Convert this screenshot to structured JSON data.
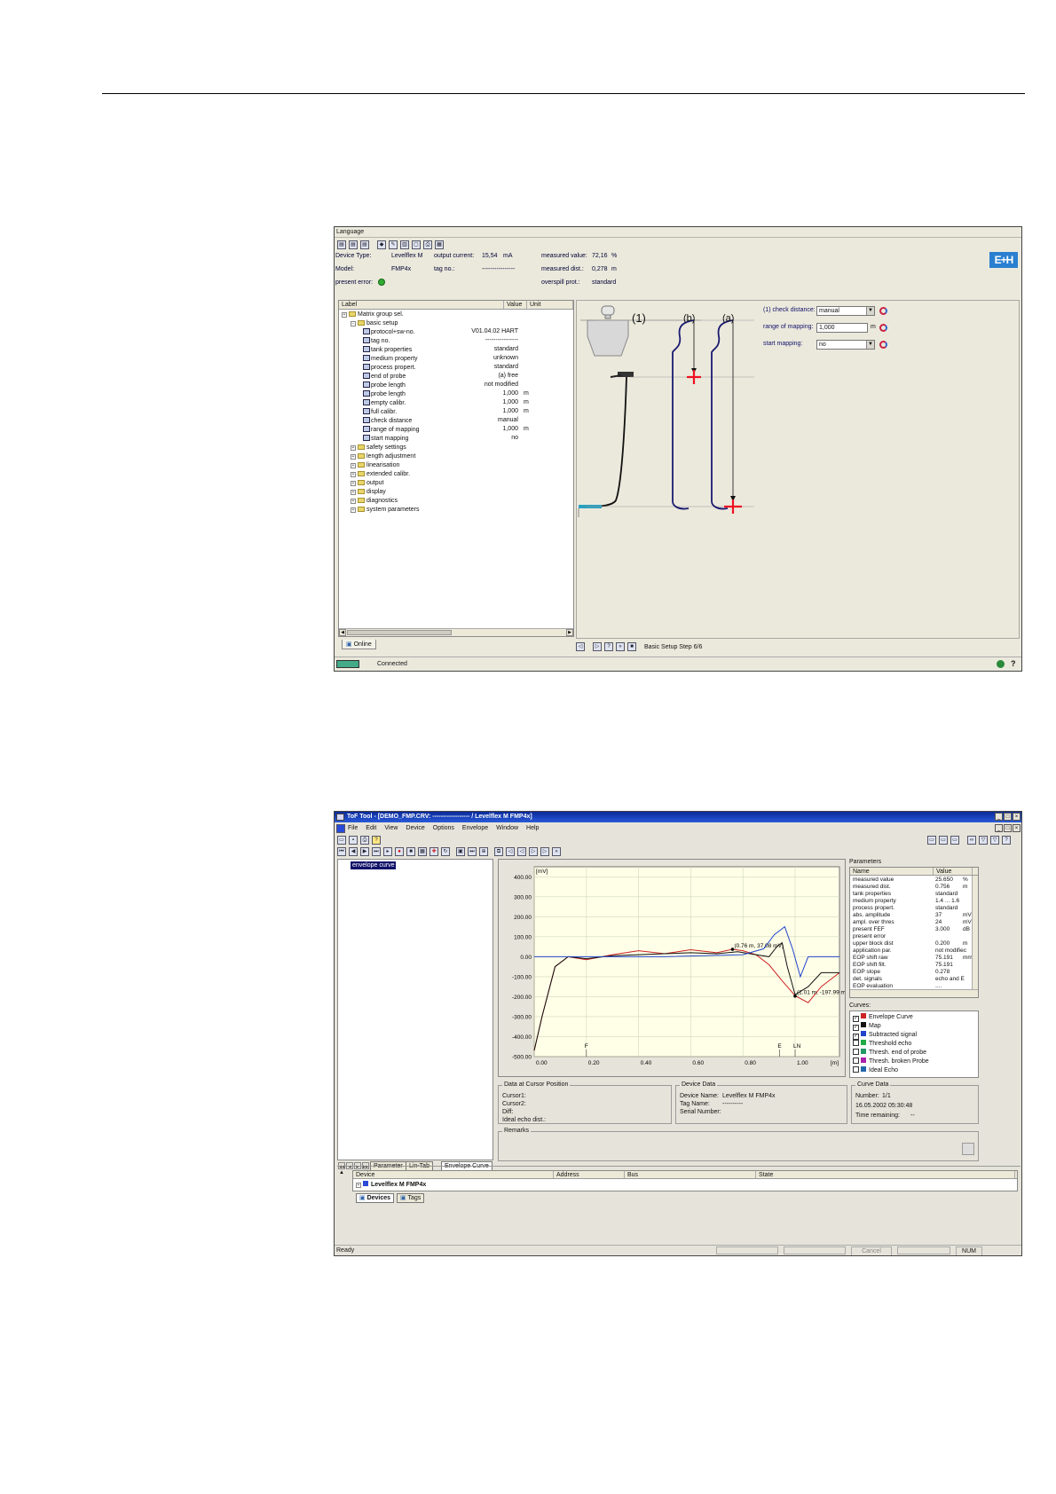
{
  "screenshot1": {
    "menu": "Language",
    "header": {
      "device_type_label": "Device Type:",
      "device_type_value": "Levelflex M",
      "model_label": "Model:",
      "model_value": "FMP4x",
      "present_error_label": "present error:",
      "output_current_label": "output current:",
      "output_current_value": "15,54",
      "output_current_unit": "mA",
      "tag_no_label": "tag no.:",
      "tag_no_value": "----------------",
      "measured_value_label": "measured value:",
      "measured_value_value": "72,16",
      "measured_value_unit": "%",
      "measured_dist_label": "measured dist.:",
      "measured_dist_value": "0,278",
      "measured_dist_unit": "m",
      "overspill_label": "overspill prot.:",
      "overspill_value": "standard",
      "logo": "E+H"
    },
    "tree": {
      "col_label": "Label",
      "col_value": "Value",
      "col_unit": "Unit",
      "root": "Matrix group sel.",
      "group": "basic setup",
      "items": [
        {
          "label": "protocol+sw-no.",
          "value": "V01.04.02 HART",
          "unit": ""
        },
        {
          "label": "tag no.",
          "value": "----------------",
          "unit": ""
        },
        {
          "label": "tank properties",
          "value": "standard",
          "unit": ""
        },
        {
          "label": "medium property",
          "value": "unknown",
          "unit": ""
        },
        {
          "label": "process propert.",
          "value": "standard",
          "unit": ""
        },
        {
          "label": "end of probe",
          "value": "(a) free",
          "unit": ""
        },
        {
          "label": "probe length",
          "value": "not modified",
          "unit": ""
        },
        {
          "label": "probe length",
          "value": "1,000",
          "unit": "m"
        },
        {
          "label": "empty calibr.",
          "value": "1,000",
          "unit": "m"
        },
        {
          "label": "full calibr.",
          "value": "1,000",
          "unit": "m"
        },
        {
          "label": "check distance",
          "value": "manual",
          "unit": ""
        },
        {
          "label": "range of mapping",
          "value": "1,000",
          "unit": "m"
        },
        {
          "label": "start mapping",
          "value": "no",
          "unit": ""
        }
      ],
      "groups": [
        "safety settings",
        "length adjustment",
        "linearisation",
        "extended calibr.",
        "output",
        "display",
        "diagnostics",
        "system parameters"
      ]
    },
    "diagram": {
      "label1": "(1)",
      "label_b": "(b)",
      "label_a": "(a)"
    },
    "fields": [
      {
        "label": "(1) check distance:",
        "value": "manual",
        "unit": ""
      },
      {
        "label": "range of mapping:",
        "value": "1,000",
        "unit": "m"
      },
      {
        "label": "start mapping:",
        "value": "no",
        "unit": ""
      }
    ],
    "online_tab": "Online",
    "step_text": "Basic Setup Step 6/6",
    "status": "Connected",
    "help": "?"
  },
  "screenshot2": {
    "title": "ToF Tool - [DEMO_FMP.CRV: ------------------ / Levelflex M FMP4x]",
    "menu": [
      "File",
      "Edit",
      "View",
      "Device",
      "Options",
      "Envelope",
      "Window",
      "Help"
    ],
    "tree_item": "envelope curve",
    "bottom_tabs": [
      "Parameter",
      "Lin-Tab",
      "Envelope Curve"
    ],
    "chart_data": {
      "type": "line",
      "ylabel": "[mV]",
      "xlabel": "[m]",
      "yticks": [
        "400.00",
        "300.00",
        "200.00",
        "100.00",
        "0.00",
        "-100.00",
        "-200.00",
        "-300.00",
        "-400.00",
        "-500.00"
      ],
      "xticks": [
        "0.00",
        "0.20",
        "0.40",
        "0.60",
        "0.80",
        "1.00"
      ],
      "xlim": [
        0,
        1.17
      ],
      "ylim": [
        -500,
        450
      ],
      "markers": [
        {
          "x": 0.2,
          "label": "F"
        },
        {
          "x": 0.94,
          "label": "E"
        },
        {
          "x": 1.0,
          "label": "LN"
        }
      ],
      "annotations": [
        {
          "x": 0.76,
          "y": 37,
          "text": "(0.76 m, 37.08 mV)"
        },
        {
          "x": 1.0,
          "y": -197,
          "text": "(1.01 m, -197.99 mV)"
        }
      ],
      "series": [
        {
          "name": "Envelope Curve",
          "color": "#cc2222",
          "x": [
            0.0,
            0.03,
            0.08,
            0.13,
            0.2,
            0.3,
            0.4,
            0.5,
            0.6,
            0.7,
            0.76,
            0.8,
            0.85,
            0.9,
            0.95,
            1.0,
            1.05,
            1.1,
            1.17
          ],
          "y": [
            -470,
            -300,
            -50,
            0,
            -15,
            10,
            30,
            15,
            35,
            20,
            37,
            30,
            10,
            -40,
            -120,
            -195,
            -230,
            -150,
            -80
          ]
        },
        {
          "name": "Map",
          "color": "#111111",
          "x": [
            0.0,
            0.03,
            0.08,
            0.13,
            0.2,
            0.3,
            0.4,
            0.5,
            0.6,
            0.7,
            0.78,
            0.85,
            0.9,
            0.93,
            0.95,
            0.97,
            1.0,
            1.05,
            1.1,
            1.17
          ],
          "y": [
            -470,
            -300,
            -50,
            0,
            -10,
            5,
            10,
            15,
            20,
            15,
            25,
            10,
            0,
            50,
            70,
            -50,
            -190,
            -150,
            -80,
            -80
          ]
        },
        {
          "name": "Subtracted signal",
          "color": "#2244cc",
          "x": [
            0.0,
            0.5,
            0.8,
            0.88,
            0.92,
            0.96,
            0.99,
            1.02,
            1.05,
            1.17
          ],
          "y": [
            0,
            0,
            10,
            40,
            110,
            150,
            40,
            -100,
            0,
            0
          ]
        }
      ]
    },
    "params": {
      "title": "Parameters",
      "col_name": "Name",
      "col_value": "Value",
      "rows": [
        [
          "measured value",
          "25.650",
          "%"
        ],
        [
          "measured dist.",
          "0.756",
          "m"
        ],
        [
          "tank properties",
          "standard",
          ""
        ],
        [
          "medium property",
          "1.4 ... 1.6",
          ""
        ],
        [
          "process propert.",
          "standard",
          ""
        ],
        [
          "abs. amplitude",
          "37",
          "mV"
        ],
        [
          "ampl. over thres",
          "24",
          "mV"
        ],
        [
          "present FEF",
          "3.000",
          "dB"
        ],
        [
          "present error",
          "",
          ""
        ],
        [
          "upper block dist",
          "0.200",
          "m"
        ],
        [
          "application par.",
          "not modifiec",
          ""
        ],
        [
          "EOP shift raw",
          "75.191",
          "mm"
        ],
        [
          "EOP shift filt.",
          "75.191",
          ""
        ],
        [
          "EOP slope",
          "0.278",
          ""
        ],
        [
          "det. signals",
          "echo and E",
          ""
        ],
        [
          "EOP evaluation",
          "....",
          ""
        ]
      ]
    },
    "curves": {
      "title": "Curves:",
      "items": [
        {
          "name": "Envelope Curve",
          "checked": true,
          "color": "#cc2222"
        },
        {
          "name": "Map",
          "checked": true,
          "color": "#111111"
        },
        {
          "name": "Subtracted signal",
          "checked": true,
          "color": "#2244cc"
        },
        {
          "name": "Threshold echo",
          "checked": false,
          "color": "#22aa44"
        },
        {
          "name": "Thresh. end of probe",
          "checked": false,
          "color": "#229966"
        },
        {
          "name": "Thresh. broken Probe",
          "checked": false,
          "color": "#aa22aa"
        },
        {
          "name": "Ideal Echo",
          "checked": false,
          "color": "#2266aa"
        }
      ]
    },
    "cursor_box": {
      "title": "Data at Cursor Position",
      "rows": [
        "Cursor1:",
        "Cursor2:",
        "Diff:",
        "Ideal echo dist.:"
      ]
    },
    "device_box": {
      "title": "Device Data",
      "rows": [
        [
          "Device Name:",
          "Levelflex M FMP4x"
        ],
        [
          "Tag Name:",
          "----------"
        ],
        [
          "Serial Number:",
          ""
        ]
      ]
    },
    "curve_box": {
      "title": "Curve Data",
      "number_label": "Number:",
      "number_value": "1/1",
      "datetime": "16.05.2002 05:30:48",
      "time_label": "Time remaining:",
      "time_value": "--"
    },
    "remarks": "Remarks",
    "devtable": {
      "cols": [
        "Device",
        "Address",
        "Bus",
        "State"
      ],
      "row": "Levelflex M FMP4x"
    },
    "dev_tabs": [
      "Devices",
      "Tags"
    ],
    "status": {
      "ready": "Ready",
      "cancel": "Cancel",
      "num": "NUM"
    }
  }
}
